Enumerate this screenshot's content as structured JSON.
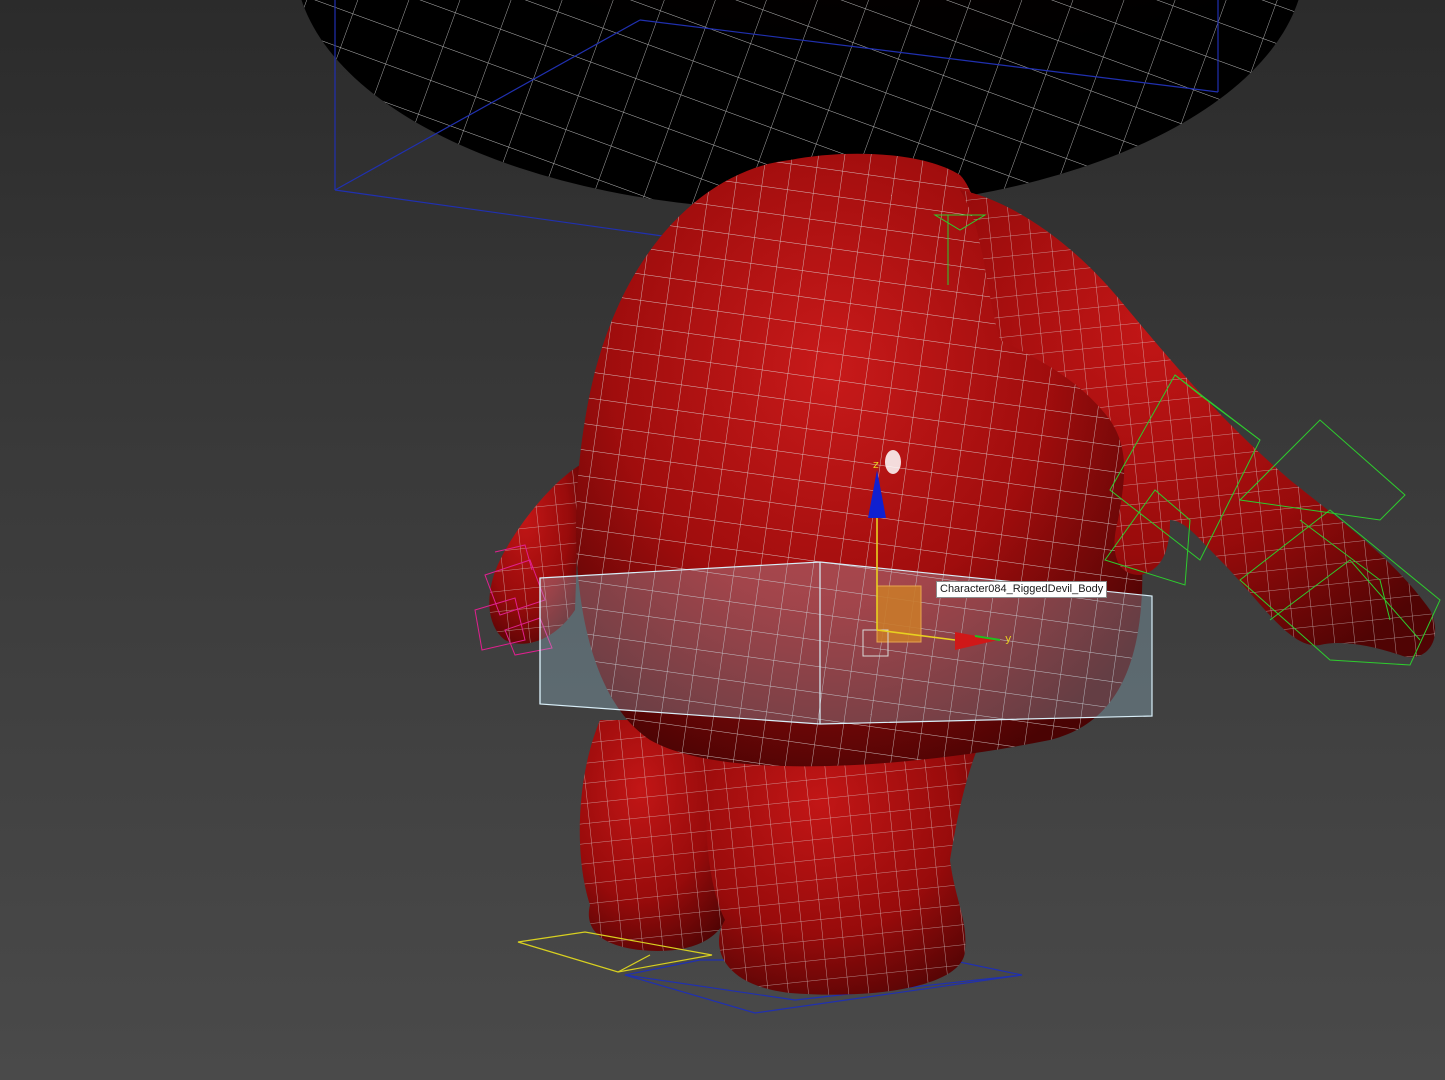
{
  "viewport": {
    "selected_object_label": "Character084_RiggedDevil_Body",
    "gizmo": {
      "z_axis_label": "z",
      "y_axis_label": "y",
      "z_axis_color": "#1020d0",
      "y_axis_color": "#20c020",
      "x_axis_color": "#d01818"
    },
    "colors": {
      "background_top": "#2b2b2b",
      "background_bottom": "#4a4a4a",
      "mesh_red": "#a00d0d",
      "wireframe": "#d9d9d9",
      "selection_box": "#bfe0f0",
      "right_hand_bones": "#2ecc2e",
      "left_hand_bones": "#e0208f",
      "foot_bone_left": "#d8d020",
      "bounding_box_blue": "#2030b0"
    }
  }
}
